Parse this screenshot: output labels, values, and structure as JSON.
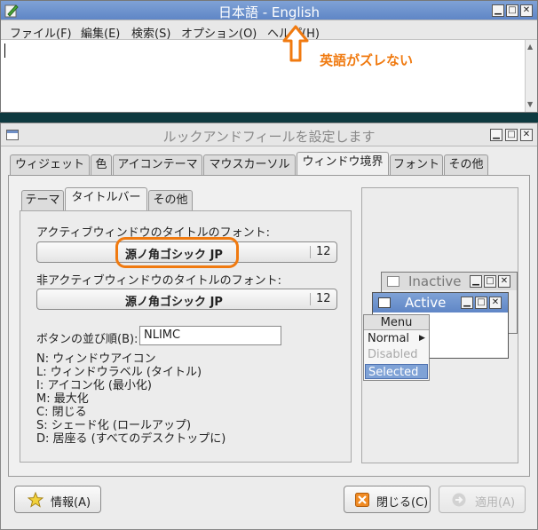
{
  "editor": {
    "title": "日本語 - English",
    "menu": [
      "ファイル(F)",
      "編集(E)",
      "検索(S)",
      "オプション(O)",
      "ヘルプ(H)"
    ],
    "annotation": "英語がズレない",
    "annotation_color": "#f07a10"
  },
  "dialog": {
    "title": "ルックアンドフィールを設定します",
    "tabs": [
      "ウィジェット",
      "色",
      "アイコンテーマ",
      "マウスカーソル",
      "ウィンドウ境界",
      "フォント",
      "その他"
    ],
    "subtabs": [
      "テーマ",
      "タイトルバー",
      "その他"
    ],
    "active_font_label": "アクティブウィンドウのタイトルのフォント:",
    "active_font_name": "源ノ角ゴシック JP",
    "active_font_size": "12",
    "inactive_font_label": "非アクティブウィンドウのタイトルのフォント:",
    "inactive_font_name": "源ノ角ゴシック JP",
    "inactive_font_size": "12",
    "button_order_label": "ボタンの並び順(B):",
    "button_order_value": "NLIMC",
    "legend": [
      "N: ウィンドウアイコン",
      "L: ウィンドウラベル (タイトル)",
      "I: アイコン化 (最小化)",
      "M: 最大化",
      "C: 閉じる",
      "S: シェード化 (ロールアップ)",
      "D: 居座る (すべてのデスクトップに)"
    ],
    "preview": {
      "inactive_title": "Inactive",
      "active_title": "Active",
      "menu_title": "Menu",
      "menu_items": [
        "Normal",
        "Disabled",
        "Selected"
      ]
    },
    "buttons": {
      "info": "情報(A)",
      "close": "閉じる(C)",
      "apply": "適用(A)"
    },
    "highlight_color": "#f07a10"
  }
}
